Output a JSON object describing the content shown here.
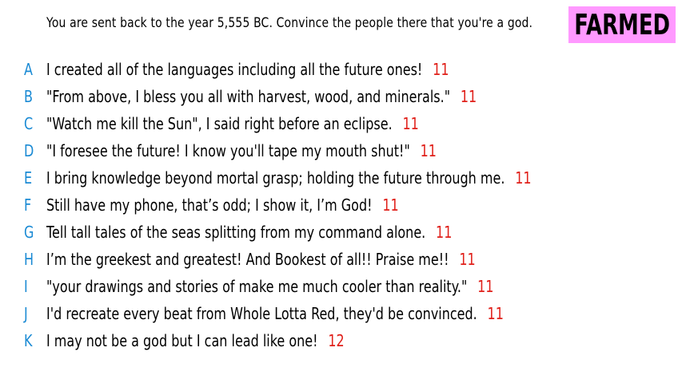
{
  "prompt": "You are sent back to the year 5,555 BC. Convince the people there that you're a god.",
  "badge": "FARMED",
  "colors": {
    "letter": "#1a8ad4",
    "score": "#e0201a",
    "badge_bg": "#ff99ff"
  },
  "answers": [
    {
      "letter": "A",
      "text": "I created all of the languages including all the future ones!",
      "score": "11"
    },
    {
      "letter": "B",
      "text": "\"From above, I bless you all with harvest, wood, and minerals.\"",
      "score": "11"
    },
    {
      "letter": "C",
      "text": "\"Watch me kill the Sun\", I said right before an eclipse.",
      "score": "11"
    },
    {
      "letter": "D",
      "text": "\"I foresee the future! I know you'll tape my mouth shut!\"",
      "score": "11"
    },
    {
      "letter": "E",
      "text": "I bring knowledge beyond mortal grasp; holding the future through me.",
      "score": "11"
    },
    {
      "letter": "F",
      "text": "Still have my phone, that’s odd; I show it, I’m God!",
      "score": "11"
    },
    {
      "letter": "G",
      "text": "Tell tall tales of the seas splitting from my command alone.",
      "score": "11"
    },
    {
      "letter": "H",
      "text": "I’m the greekest and greatest! And Bookest of all!! Praise me!!",
      "score": "11"
    },
    {
      "letter": "I",
      "text": "\"your drawings and stories of make me much cooler than reality.\"",
      "score": "11"
    },
    {
      "letter": "J",
      "text": "I'd recreate every beat from Whole Lotta Red, they'd be convinced.",
      "score": "11"
    },
    {
      "letter": "K",
      "text": "I may not be a god but I can lead like one!",
      "score": "12"
    }
  ]
}
